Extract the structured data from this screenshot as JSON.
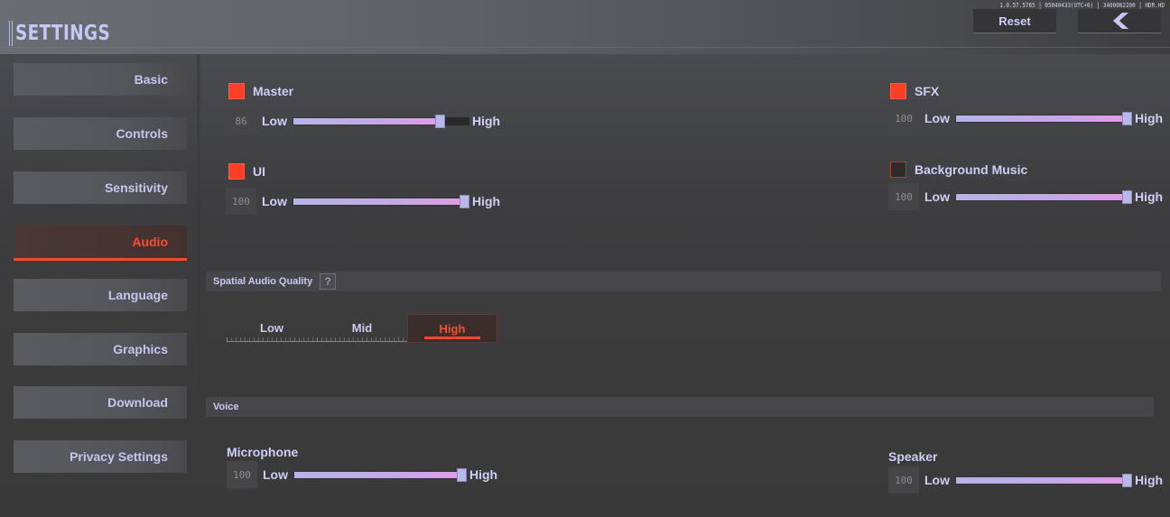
{
  "header": {
    "title": "SETTINGS",
    "version": "1.0.57.5765 | 05040433(UTC+0) | 3400082200 | HDR.HD",
    "reset_label": "Reset",
    "back_icon": "chevron-left-icon"
  },
  "sidebar": {
    "items": [
      {
        "label": "Basic",
        "active": false
      },
      {
        "label": "Controls",
        "active": false
      },
      {
        "label": "Sensitivity",
        "active": false
      },
      {
        "label": "Audio",
        "active": true
      },
      {
        "label": "Language",
        "active": false
      },
      {
        "label": "Graphics",
        "active": false
      },
      {
        "label": "Download",
        "active": false
      },
      {
        "label": "Privacy Settings",
        "active": false
      }
    ]
  },
  "audio": {
    "low_label": "Low",
    "high_label": "High",
    "master": {
      "label": "Master",
      "enabled": true,
      "value": 86
    },
    "ui": {
      "label": "UI",
      "enabled": true,
      "value": 100
    },
    "sfx": {
      "label": "SFX",
      "enabled": true,
      "value": 100
    },
    "bgm": {
      "label": "Background Music",
      "enabled": false,
      "value": 100
    }
  },
  "spatial": {
    "title": "Spatial Audio Quality",
    "help_icon": "?",
    "options": [
      "Low",
      "Mid",
      "High"
    ],
    "selected": "High"
  },
  "voice": {
    "title": "Voice",
    "microphone": {
      "label": "Microphone",
      "value": 100
    },
    "speaker": {
      "label": "Speaker",
      "value": 100
    }
  },
  "colors": {
    "accent": "#ff4630",
    "text": "#c9c8f0",
    "slider_fill": "#c3a8e8"
  }
}
